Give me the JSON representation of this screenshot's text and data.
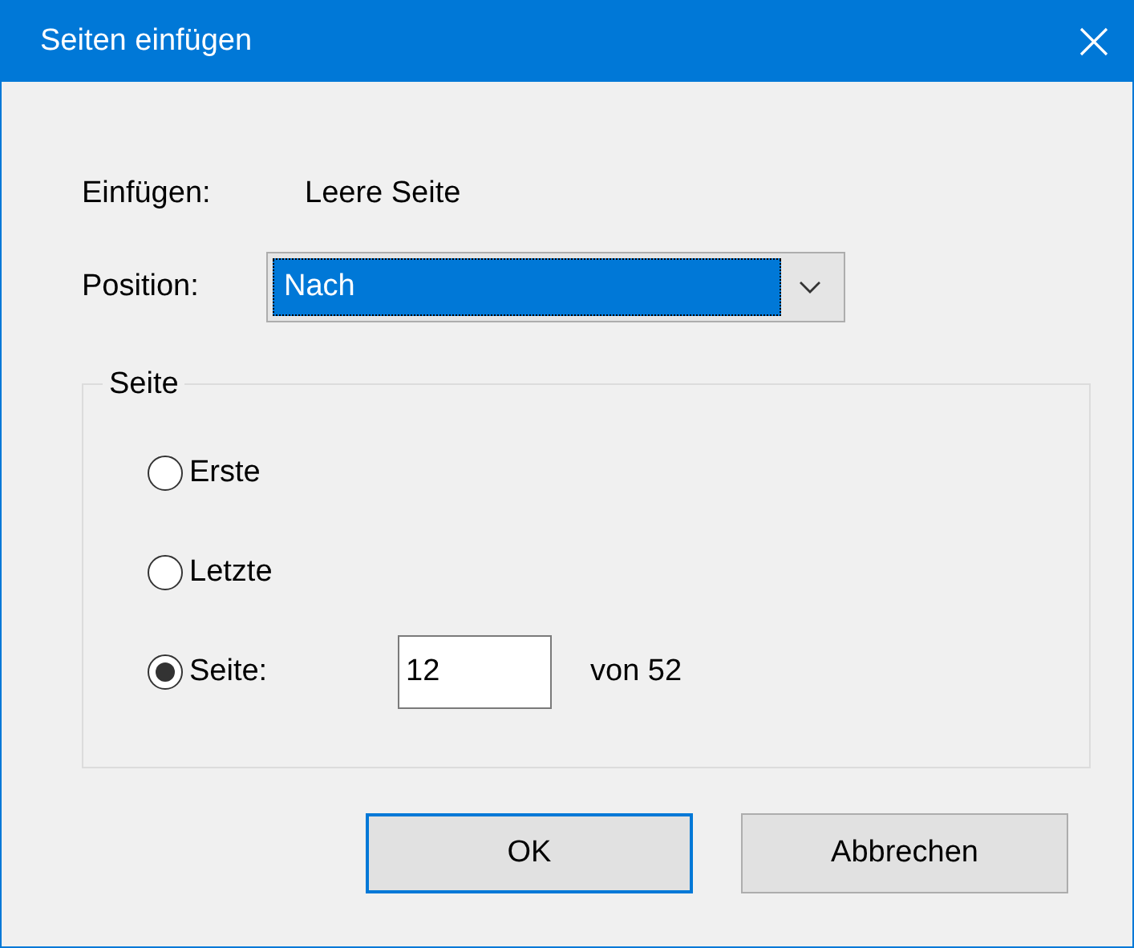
{
  "window": {
    "title": "Seiten einfügen"
  },
  "insert": {
    "label": "Einfügen:",
    "value": "Leere Seite"
  },
  "position": {
    "label": "Position:",
    "value": "Nach"
  },
  "group": {
    "title": "Seite",
    "options": [
      {
        "kind": "plain",
        "label": "Erste",
        "selected": false
      },
      {
        "kind": "plain",
        "label": "Letzte",
        "selected": false
      },
      {
        "kind": "page",
        "label": "Seite:",
        "selected": true,
        "value": "12",
        "suffix": "von 52"
      }
    ]
  },
  "buttons": [
    {
      "label": "OK",
      "default": true
    },
    {
      "label": "Abbrechen",
      "default": false
    }
  ]
}
